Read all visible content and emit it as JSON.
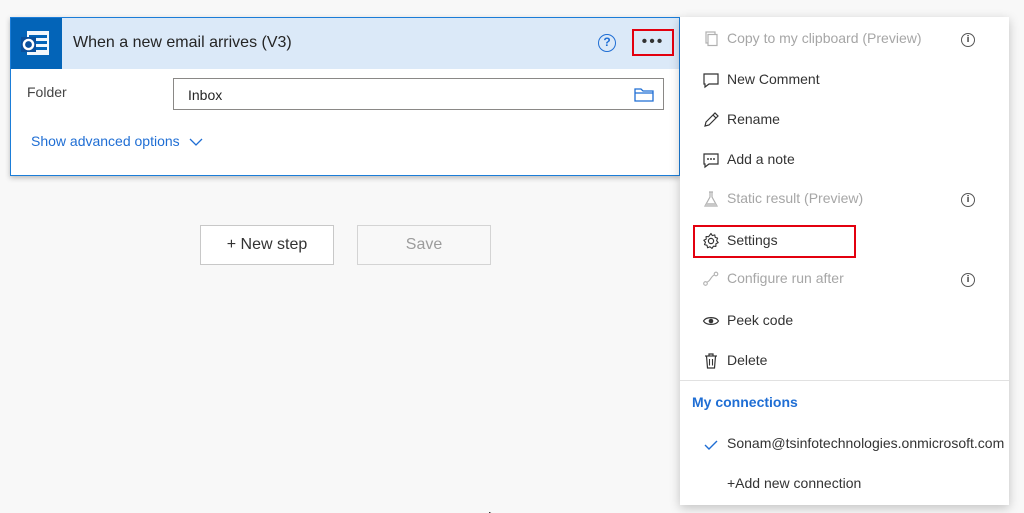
{
  "trigger": {
    "title": "When a new email arrives (V3)",
    "help_glyph": "?",
    "more_glyph": "•••",
    "folder_label": "Folder",
    "folder_value": "Inbox",
    "advanced_label": "Show advanced options"
  },
  "actions": {
    "new_step_label": "+ New step",
    "save_label": "Save"
  },
  "menu": {
    "items": [
      {
        "label": "Copy to my clipboard (Preview)",
        "icon": "copy-icon",
        "disabled": true,
        "info": true
      },
      {
        "label": "New Comment",
        "icon": "comment-icon",
        "disabled": false,
        "info": false
      },
      {
        "label": "Rename",
        "icon": "pencil-icon",
        "disabled": false,
        "info": false
      },
      {
        "label": "Add a note",
        "icon": "note-icon",
        "disabled": false,
        "info": false
      },
      {
        "label": "Static result (Preview)",
        "icon": "flask-icon",
        "disabled": true,
        "info": true
      },
      {
        "label": "Settings",
        "icon": "gear-icon",
        "disabled": false,
        "info": false,
        "highlighted": true
      },
      {
        "label": "Configure run after",
        "icon": "run-after-icon",
        "disabled": true,
        "info": true
      },
      {
        "label": "Peek code",
        "icon": "eye-icon",
        "disabled": false,
        "info": false
      },
      {
        "label": "Delete",
        "icon": "trash-icon",
        "disabled": false,
        "info": false
      }
    ],
    "info_glyph": "i",
    "connections_header": "My connections",
    "connection": "Sonam@tsinfotechnologies.onmicrosoft.com",
    "add_connection": "+Add new connection"
  },
  "colors": {
    "accent": "#1f6ed4",
    "header_bg": "#dbe9f8",
    "highlight": "#e3000f",
    "outlook": "#0364b8"
  }
}
